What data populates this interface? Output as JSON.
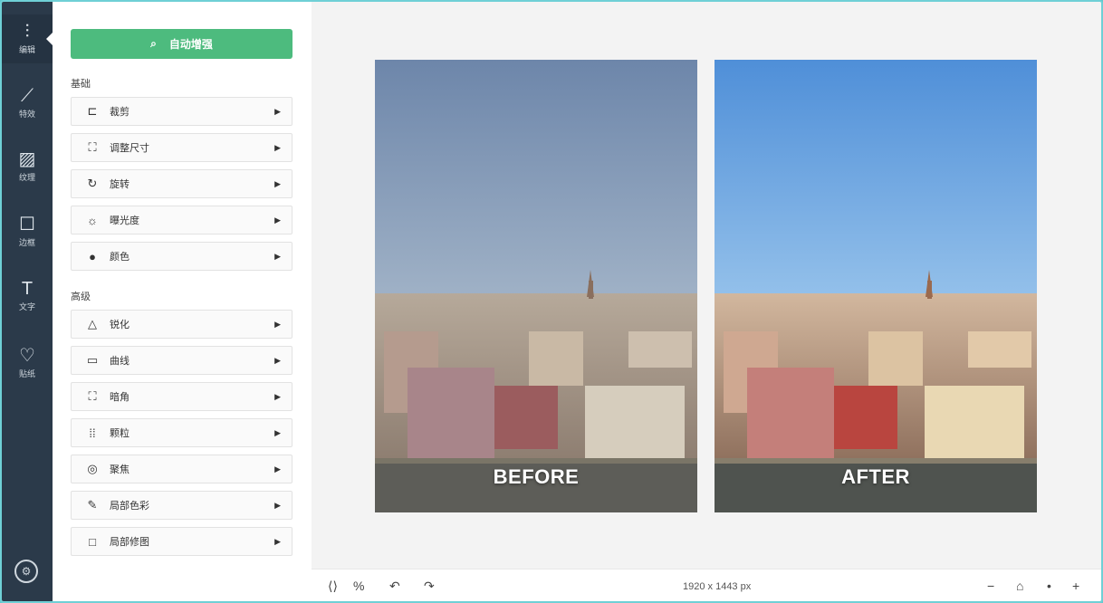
{
  "rail": {
    "items": [
      {
        "icon": "sliders-icon",
        "glyph": "⫶",
        "label": "编辑"
      },
      {
        "icon": "magic-wand-icon",
        "glyph": "⟋",
        "label": "特效"
      },
      {
        "icon": "texture-icon",
        "glyph": "▨",
        "label": "纹理"
      },
      {
        "icon": "frame-icon",
        "glyph": "☐",
        "label": "边框"
      },
      {
        "icon": "text-icon",
        "glyph": "T",
        "label": "文字"
      },
      {
        "icon": "heart-icon",
        "glyph": "♡",
        "label": "贴纸"
      }
    ]
  },
  "panel": {
    "primary_button": "自动增强",
    "basic_title": "基础",
    "basic_tools": [
      {
        "icon": "crop-icon",
        "glyph": "⊏",
        "label": "裁剪"
      },
      {
        "icon": "resize-icon",
        "glyph": "⛶",
        "label": "调整尺寸"
      },
      {
        "icon": "rotate-icon",
        "glyph": "↻",
        "label": "旋转"
      },
      {
        "icon": "exposure-icon",
        "glyph": "☼",
        "label": "曝光度"
      },
      {
        "icon": "color-icon",
        "glyph": "●",
        "label": "颜色"
      }
    ],
    "advanced_title": "高级",
    "advanced_tools": [
      {
        "icon": "sharpen-icon",
        "glyph": "△",
        "label": "锐化"
      },
      {
        "icon": "curves-icon",
        "glyph": "▭",
        "label": "曲线"
      },
      {
        "icon": "vignette-icon",
        "glyph": "⛶",
        "label": "暗角"
      },
      {
        "icon": "grain-icon",
        "glyph": "⁞⁞",
        "label": "颗粒"
      },
      {
        "icon": "focus-icon",
        "glyph": "◎",
        "label": "聚焦"
      },
      {
        "icon": "selective-color-icon",
        "glyph": "✎",
        "label": "局部色彩"
      },
      {
        "icon": "clone-icon",
        "glyph": "□",
        "label": "局部修图"
      }
    ]
  },
  "canvas": {
    "before_label": "BEFORE",
    "after_label": "AFTER"
  },
  "bottombar": {
    "size_text": "1920 x 1443 px",
    "compare_glyph": "⟨⟩",
    "percent_glyph": "%",
    "undo_glyph": "↶",
    "redo_glyph": "↷",
    "zoom_out_glyph": "−",
    "fit_glyph": "⌂",
    "dot_glyph": "•",
    "zoom_in_glyph": "+"
  },
  "colors": {
    "rail": "#2b3a4a",
    "accent": "#4dbb7e",
    "before_sky": "#6f89ad",
    "after_sky": "#5e9ad6"
  }
}
